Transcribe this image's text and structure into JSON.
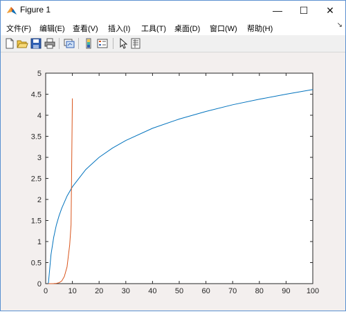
{
  "window": {
    "title": "Figure 1"
  },
  "window_controls": {
    "minimize": "—",
    "maximize": "☐",
    "close": "✕"
  },
  "menu": {
    "items": [
      "文件(F)",
      "编辑(E)",
      "查看(V)",
      "插入(I)",
      "工具(T)",
      "桌面(D)",
      "窗口(W)",
      "帮助(H)"
    ],
    "dock_arrow": "↘"
  },
  "toolbar": {
    "buttons": [
      "new-figure-icon",
      "open-file-icon",
      "save-icon",
      "print-icon",
      "link-plot-icon",
      "insert-colorbar-icon",
      "insert-legend-icon",
      "edit-plot-pointer-icon",
      "property-inspector-icon"
    ]
  },
  "chart_data": {
    "type": "line",
    "title": "",
    "xlabel": "",
    "ylabel": "",
    "xlim": [
      0,
      100
    ],
    "ylim": [
      0,
      5
    ],
    "xticks": [
      0,
      10,
      20,
      30,
      40,
      50,
      60,
      70,
      80,
      90,
      100
    ],
    "yticks": [
      "0",
      "0.5",
      "1",
      "1.5",
      "2",
      "2.5",
      "3",
      "3.5",
      "4",
      "4.5",
      "5"
    ],
    "grid": false,
    "series": [
      {
        "color": "#0072BD",
        "x": [
          1,
          2,
          3,
          4,
          5,
          6,
          8,
          10,
          15,
          20,
          25,
          30,
          40,
          50,
          60,
          70,
          80,
          90,
          100
        ],
        "y": [
          0,
          0.69,
          1.1,
          1.39,
          1.61,
          1.79,
          2.08,
          2.3,
          2.71,
          3.0,
          3.22,
          3.4,
          3.69,
          3.91,
          4.09,
          4.25,
          4.38,
          4.5,
          4.61
        ]
      },
      {
        "color": "#D95319",
        "x": [
          1,
          2,
          3,
          4,
          5,
          6,
          7,
          8,
          9,
          9.5,
          10
        ],
        "y": [
          0,
          0.0002,
          0.0013,
          0.0059,
          0.021,
          0.063,
          0.17,
          0.4,
          0.92,
          1.4,
          4.4
        ]
      }
    ]
  }
}
